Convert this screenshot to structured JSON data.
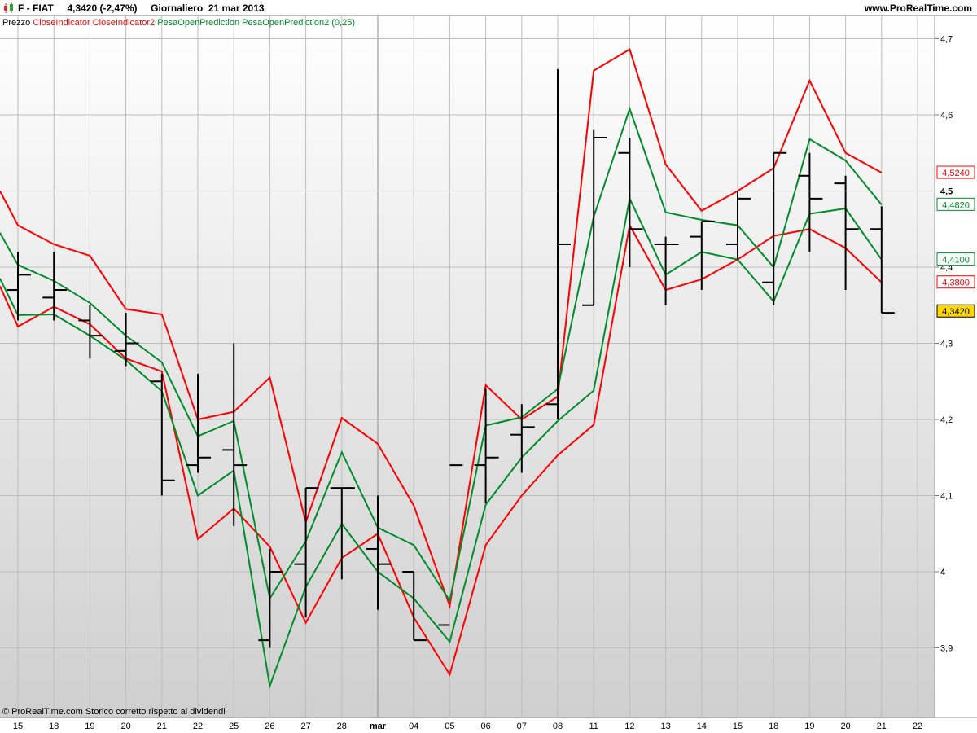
{
  "header": {
    "symbol": "F - FIAT",
    "quote": "4,3420 (-2,47%)",
    "period_date": "Giornaliero  21 mar 2013",
    "site": "www.ProRealTime.com"
  },
  "legend": {
    "prezzo": "Prezzo",
    "close1": "CloseIndicator",
    "close2": "CloseIndicator2",
    "pesa1": "PesaOpenPrediction",
    "pesa2": "PesaOpenPrediction2 (0,25)"
  },
  "footer_note": "© ProRealTime.com  Storico corretto rispetto ai dividendi",
  "colors": {
    "price": "#000000",
    "close_indicator": "#ff0000",
    "pesa_indicator": "#008c2a",
    "last_price_bg": "#ffd700"
  },
  "chart_data": {
    "type": "line",
    "x_labels": [
      "15",
      "18",
      "19",
      "20",
      "21",
      "22",
      "25",
      "26",
      "27",
      "28",
      "mar",
      "04",
      "05",
      "06",
      "07",
      "08",
      "11",
      "12",
      "13",
      "14",
      "15",
      "18",
      "19",
      "20",
      "21",
      "22"
    ],
    "bold_x_labels": [
      "mar"
    ],
    "y_ticks": [
      "3,9",
      "4",
      "4,1",
      "4,2",
      "4,3",
      "4,4",
      "4,5",
      "4,6",
      "4,7"
    ],
    "bold_y_ticks": [
      "4",
      "4,5"
    ],
    "y_tick_values": [
      3.9,
      4.0,
      4.1,
      4.2,
      4.3,
      4.4,
      4.5,
      4.6,
      4.7
    ],
    "ylim": [
      3.82,
      4.72
    ],
    "price_bars": {
      "high": [
        4.42,
        4.42,
        4.35,
        4.34,
        4.26,
        4.26,
        4.3,
        4.03,
        4.11,
        4.11,
        4.1,
        4.0,
        3.96,
        4.24,
        4.22,
        4.66,
        4.58,
        4.57,
        4.44,
        4.46,
        4.5,
        4.55,
        4.55,
        4.52,
        4.48
      ],
      "low": [
        4.33,
        4.33,
        4.28,
        4.27,
        4.1,
        4.13,
        4.06,
        3.9,
        3.94,
        3.99,
        3.95,
        3.91,
        3.96,
        4.09,
        4.13,
        4.2,
        4.35,
        4.4,
        4.35,
        4.37,
        4.41,
        4.35,
        4.42,
        4.37,
        4.34
      ],
      "open": [
        4.37,
        4.36,
        4.33,
        4.29,
        4.25,
        4.14,
        4.16,
        3.91,
        4.01,
        4.11,
        4.03,
        4.0,
        3.93,
        4.14,
        4.18,
        4.22,
        4.35,
        4.55,
        4.43,
        4.44,
        4.43,
        4.38,
        4.52,
        4.51,
        4.45
      ],
      "close": [
        4.39,
        4.37,
        4.31,
        4.3,
        4.12,
        4.15,
        4.14,
        4.0,
        4.11,
        4.11,
        4.01,
        3.91,
        4.14,
        4.15,
        4.19,
        4.43,
        4.57,
        4.45,
        4.43,
        4.46,
        4.49,
        4.55,
        4.49,
        4.45,
        4.34
      ]
    },
    "series": [
      {
        "color": "#ff0000",
        "values": [
          4.5,
          4.455,
          4.43,
          4.415,
          4.345,
          4.338,
          4.2,
          4.21,
          4.255,
          4.065,
          4.202,
          4.168,
          4.087,
          3.955,
          4.245,
          4.2,
          4.23,
          4.658,
          4.686,
          4.535,
          4.474,
          4.5,
          4.53,
          4.645,
          4.55,
          4.524
        ]
      },
      {
        "color": "#ff0000",
        "values": [
          4.375,
          4.322,
          4.348,
          4.325,
          4.28,
          4.263,
          4.043,
          4.083,
          4.033,
          3.933,
          4.018,
          4.05,
          3.94,
          3.865,
          4.035,
          4.1,
          4.153,
          4.193,
          4.455,
          4.37,
          4.384,
          4.41,
          4.441,
          4.45,
          4.425,
          4.38
        ]
      },
      {
        "color": "#008c2a",
        "values": [
          4.445,
          4.403,
          4.382,
          4.353,
          4.31,
          4.275,
          4.178,
          4.198,
          3.965,
          4.04,
          4.157,
          4.058,
          4.035,
          3.962,
          4.192,
          4.203,
          4.24,
          4.466,
          4.608,
          4.472,
          4.462,
          4.455,
          4.4,
          4.568,
          4.54,
          4.482
        ]
      },
      {
        "color": "#008c2a",
        "values": [
          4.385,
          4.337,
          4.338,
          4.31,
          4.278,
          4.237,
          4.1,
          4.133,
          3.85,
          3.98,
          4.063,
          4.0,
          3.965,
          3.908,
          4.088,
          4.15,
          4.198,
          4.238,
          4.49,
          4.39,
          4.42,
          4.41,
          4.355,
          4.47,
          4.477,
          4.41
        ]
      }
    ],
    "last_values": [
      {
        "label": "4,5240",
        "value": 4.524,
        "color": "#ff0000",
        "bg": "#ffffff"
      },
      {
        "label": "4,4820",
        "value": 4.482,
        "color": "#008c2a",
        "bg": "#ffffff"
      },
      {
        "label": "4,4100",
        "value": 4.41,
        "color": "#008c2a",
        "bg": "#ffffff"
      },
      {
        "label": "4,3800",
        "value": 4.38,
        "color": "#ff0000",
        "bg": "#ffffff"
      },
      {
        "label": "4,3420",
        "value": 4.342,
        "color": "#000000",
        "bg": "#ffd700"
      }
    ],
    "grid": true,
    "background_gradient": [
      "#ffffff",
      "#cfcfcf"
    ]
  }
}
